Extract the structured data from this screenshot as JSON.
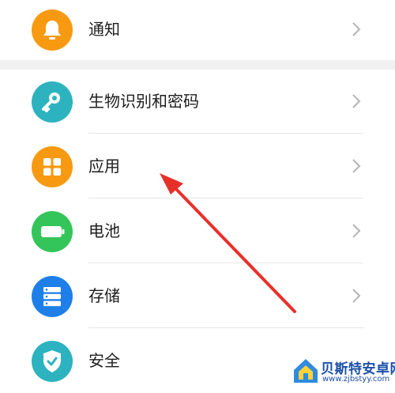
{
  "settings": {
    "items": [
      {
        "label": "通知",
        "icon": "bell-icon",
        "icon_color": "#F79A12"
      },
      {
        "label": "生物识别和密码",
        "icon": "key-icon",
        "icon_color": "#2DB3BF"
      },
      {
        "label": "应用",
        "icon": "grid-apps-icon",
        "icon_color": "#F79A12"
      },
      {
        "label": "电池",
        "icon": "battery-icon",
        "icon_color": "#34C55A"
      },
      {
        "label": "存储",
        "icon": "storage-icon",
        "icon_color": "#1F7FE8"
      },
      {
        "label": "安全",
        "icon": "shield-check-icon",
        "icon_color": "#2DB3BF"
      }
    ]
  },
  "annotation": {
    "arrow_color": "#E8302A"
  },
  "watermark": {
    "name": "贝斯特安卓网",
    "url": "www.zjbstyy.com"
  }
}
